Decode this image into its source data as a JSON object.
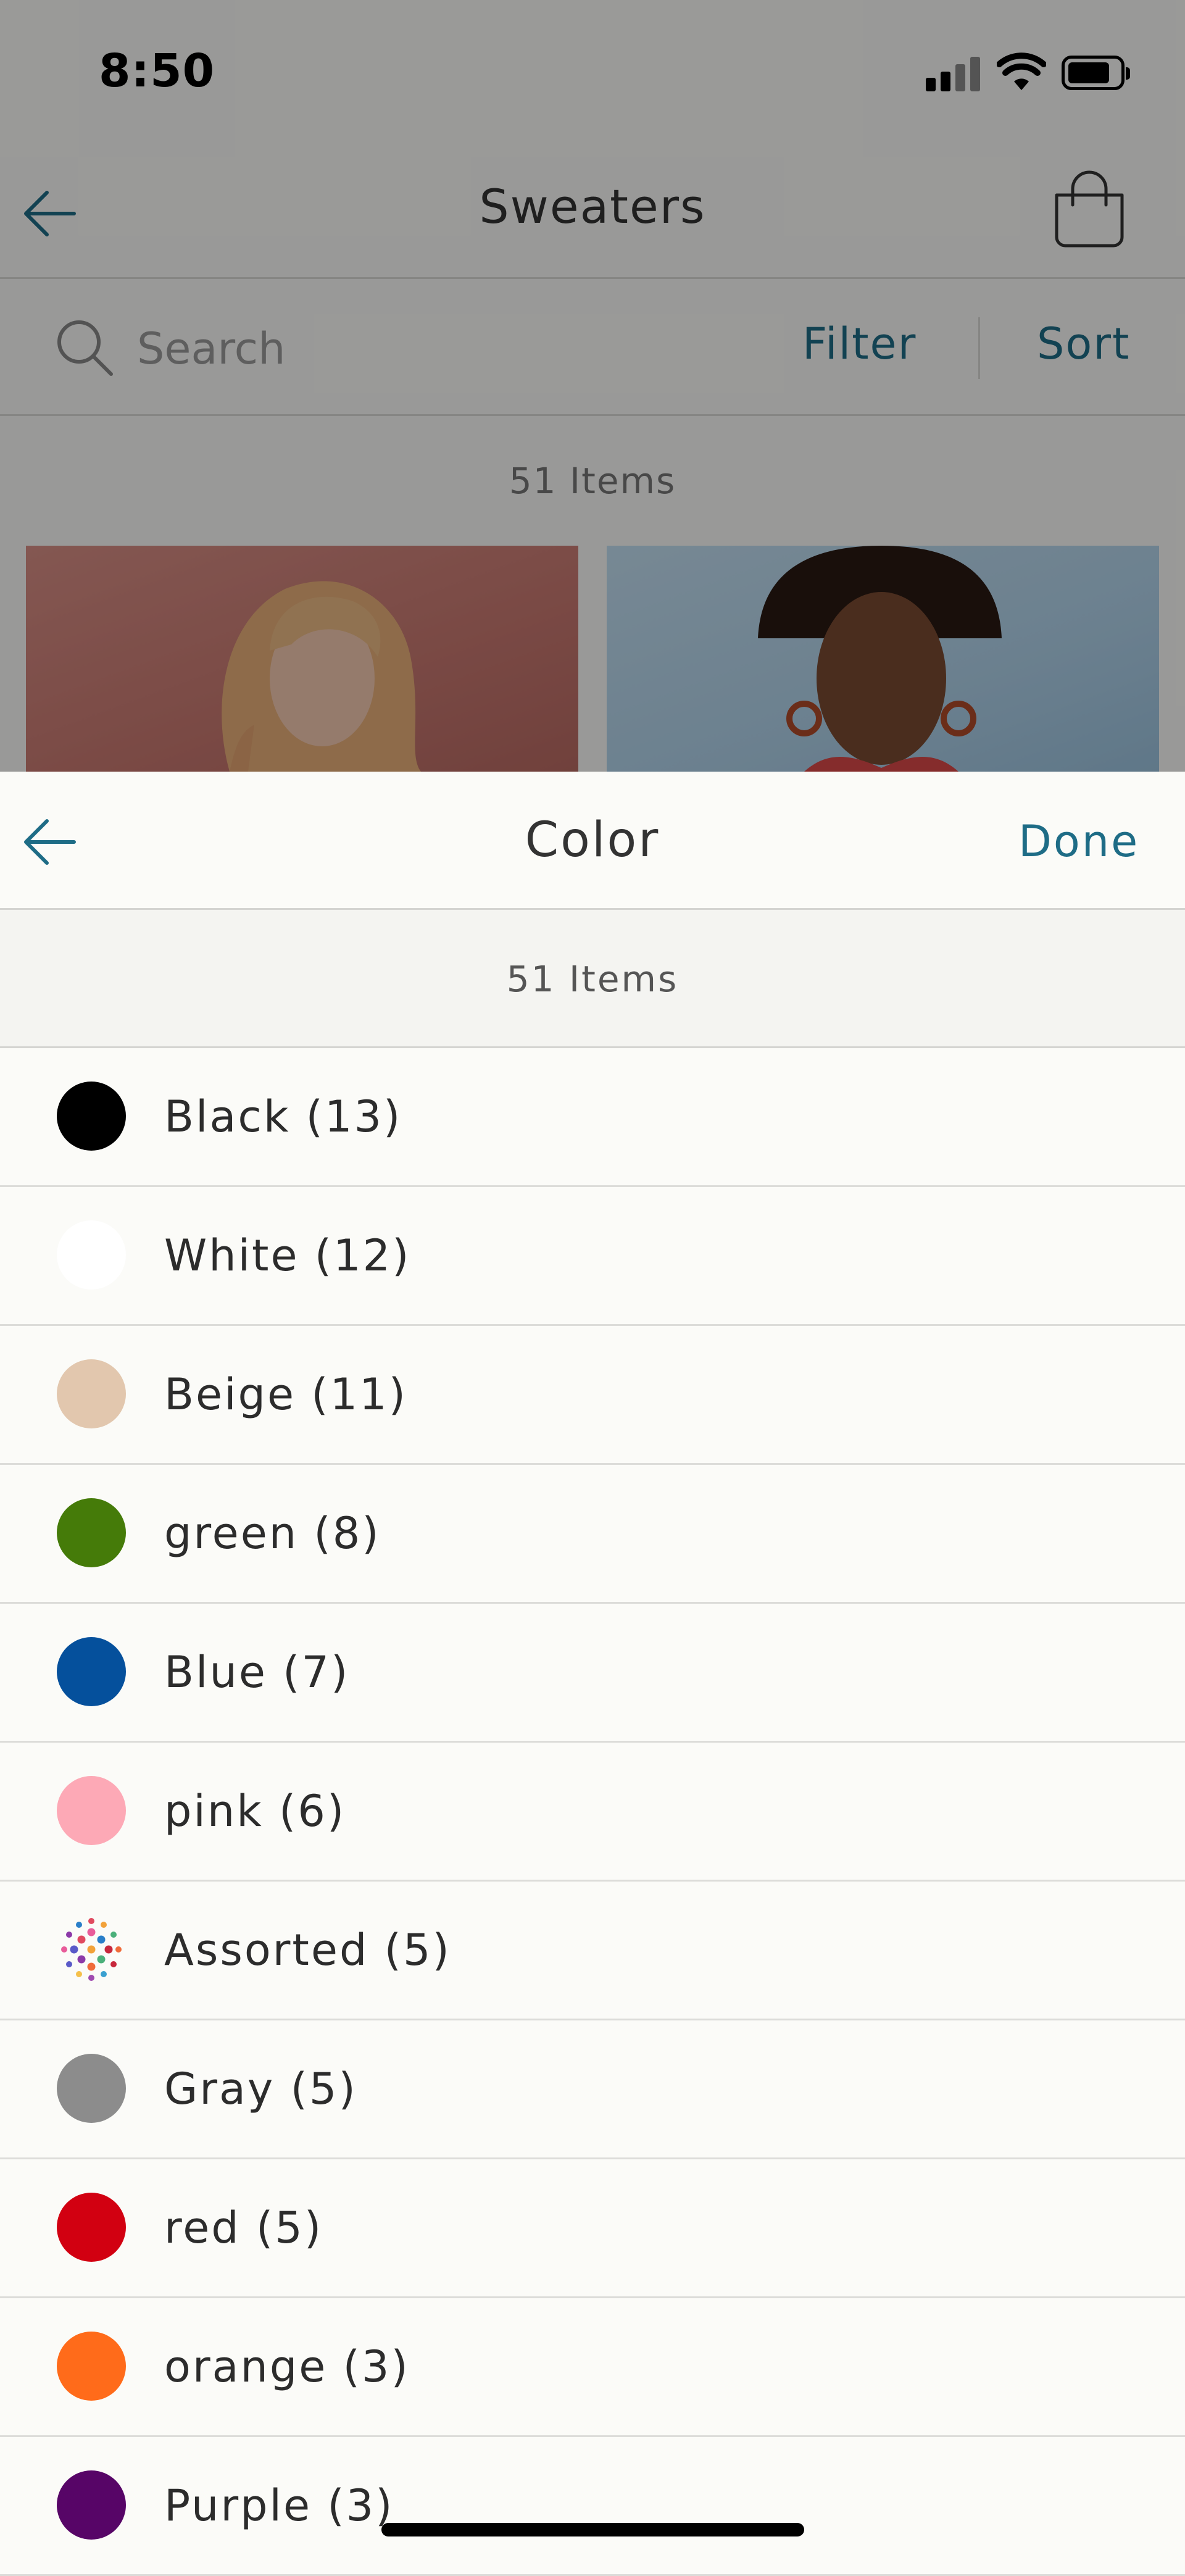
{
  "status_bar": {
    "time": "8:50"
  },
  "background_page": {
    "title": "Sweaters",
    "search": {
      "placeholder": "Search"
    },
    "filter_label": "Filter",
    "sort_label": "Sort",
    "item_count": "51 Items"
  },
  "color_sheet": {
    "title": "Color",
    "done_label": "Done",
    "item_count": "51 Items",
    "colors": [
      {
        "label": "Black (13)",
        "swatch": "#000000"
      },
      {
        "label": "White (12)",
        "swatch": "#ffffff"
      },
      {
        "label": "Beige (11)",
        "swatch": "#e2c7ae"
      },
      {
        "label": "green (8)",
        "swatch": "#457b09"
      },
      {
        "label": "Blue (7)",
        "swatch": "#05509c"
      },
      {
        "label": "pink (6)",
        "swatch": "#fda9b6"
      },
      {
        "label": "Assorted (5)",
        "swatch": "assorted"
      },
      {
        "label": "Gray (5)",
        "swatch": "#8c8c8c"
      },
      {
        "label": "red (5)",
        "swatch": "#d20011"
      },
      {
        "label": "orange (3)",
        "swatch": "#ff6b1a"
      },
      {
        "label": "Purple (3)",
        "swatch": "#570567"
      }
    ]
  },
  "colors": {
    "accent": "#1e6c86",
    "text": "#2c2c2c",
    "sheet_background": "#fbfbf8"
  }
}
